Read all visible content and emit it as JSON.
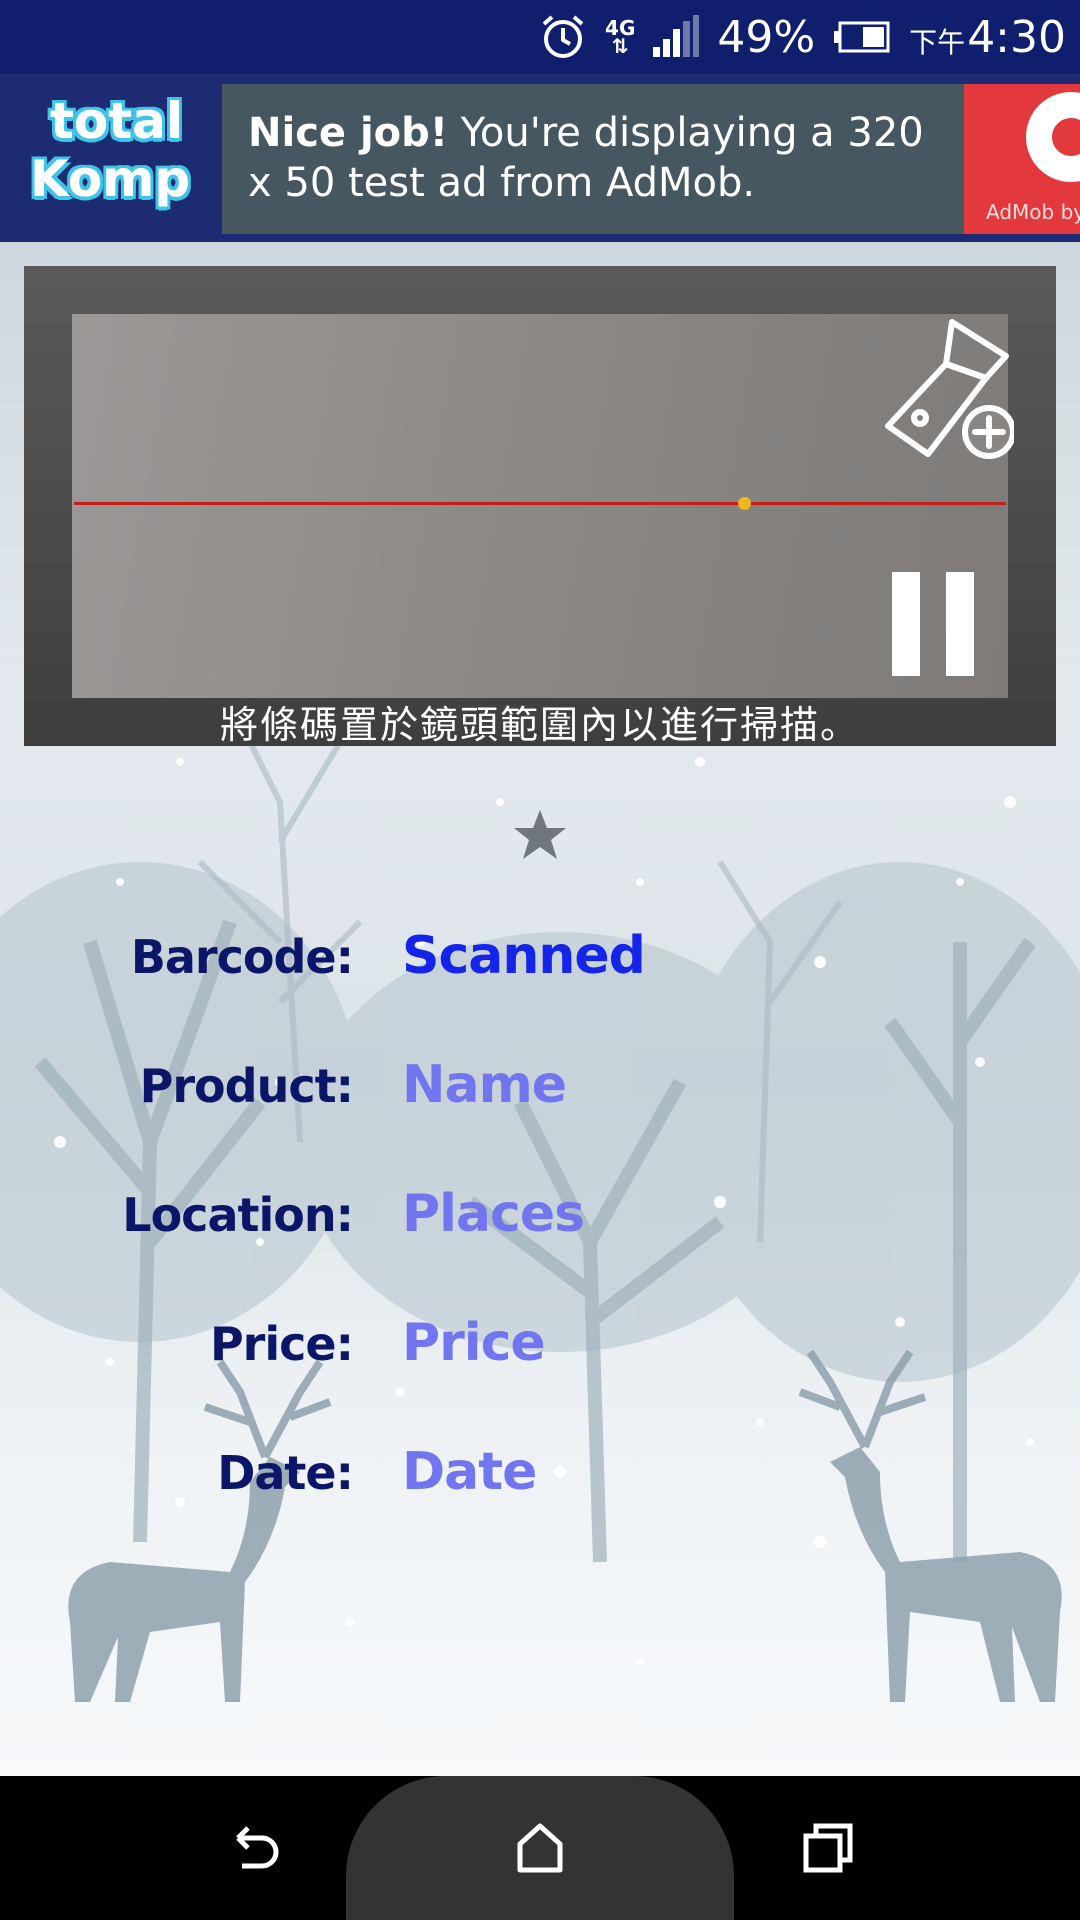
{
  "status_bar": {
    "network": "4G",
    "battery": "49%",
    "time_prefix": "下午",
    "time": "4:30"
  },
  "ad": {
    "logo_line1": "total",
    "logo_line2": "Komp",
    "headline": "Nice job!",
    "body": " You're displaying a 320 x 50 test ad from AdMob.",
    "badge_text": "AdMob by Google"
  },
  "scanner": {
    "hint": "將條碼置於鏡頭範圍內以進行掃描。"
  },
  "fields": [
    {
      "label": "Barcode:",
      "value": "Scanned"
    },
    {
      "label": "Product:",
      "value": "Name"
    },
    {
      "label": "Location:",
      "value": "Places"
    },
    {
      "label": "Price:",
      "value": "Price"
    },
    {
      "label": "Date:",
      "value": "Date"
    }
  ],
  "colors": {
    "status_bar": "#0f1f6e",
    "label": "#0c1668",
    "value_primary": "#1424e8",
    "value": "#7275f0",
    "laser": "#c81d1d"
  }
}
